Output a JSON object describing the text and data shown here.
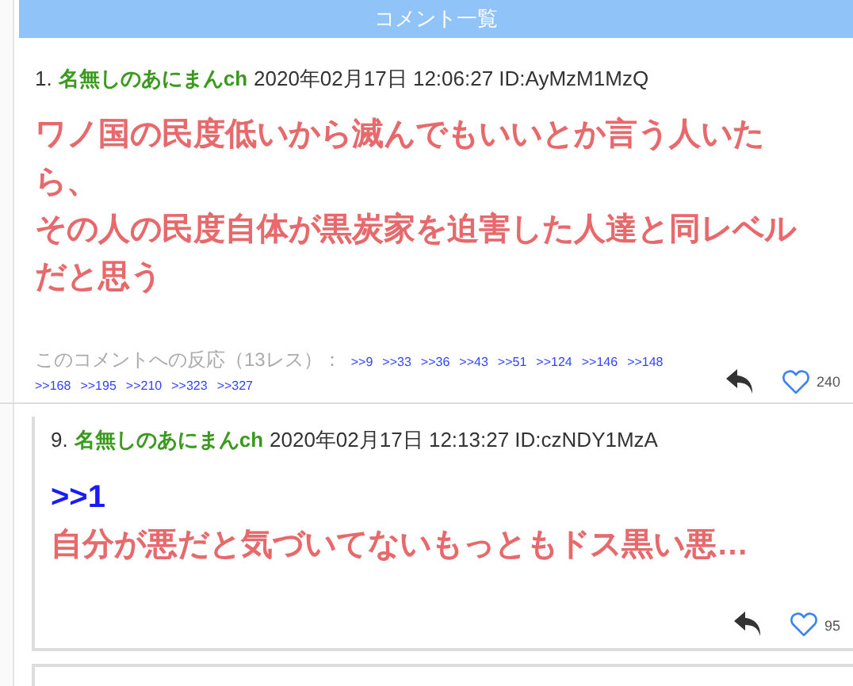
{
  "header": {
    "title": "コメント一覧"
  },
  "comments": [
    {
      "kind": "top",
      "number": "1.",
      "name": "名無しのあにまんch",
      "meta": "2020年02月17日 12:06:27 ID:AyMzM1MzQ",
      "body": [
        "ワノ国の民度低いから滅んでもいいとか言う人いたら、",
        "その人の民度自体が黒炭家を迫害した人達と同レベルだと思う"
      ],
      "reactions_label": "このコメントへの反応（13レス）：",
      "reactions": [
        ">>9",
        ">>33",
        ">>36",
        ">>43",
        ">>51",
        ">>124",
        ">>146",
        ">>148",
        ">>168",
        ">>195",
        ">>210",
        ">>323",
        ">>327"
      ],
      "likes": "240"
    },
    {
      "kind": "reply",
      "number": "9.",
      "name": "名無しのあにまんch",
      "meta": "2020年02月17日 12:13:27 ID:czNDY1MzA",
      "anchor": ">>1",
      "body": [
        "自分が悪だと気づいてないもっともドス黒い悪…"
      ],
      "likes": "95"
    }
  ]
}
